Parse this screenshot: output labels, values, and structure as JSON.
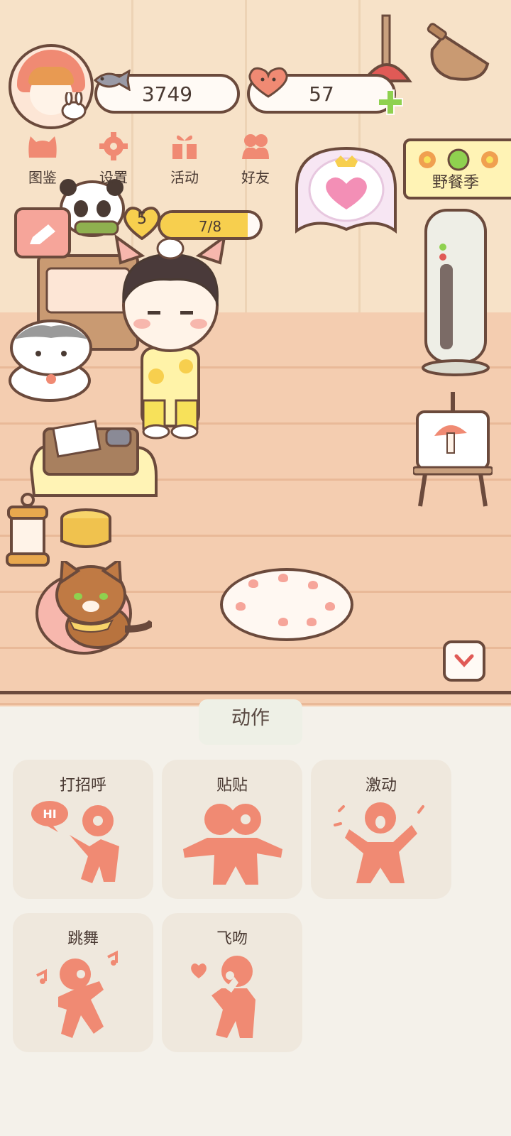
{
  "hud": {
    "coins": "3749",
    "hearts": "57"
  },
  "menu": [
    {
      "label": "图鉴",
      "icon": "cat-face-icon"
    },
    {
      "label": "设置",
      "icon": "gear-icon"
    },
    {
      "label": "活动",
      "icon": "gift-icon"
    },
    {
      "label": "好友",
      "icon": "friends-icon"
    }
  ],
  "event_banner": {
    "label": "野餐季"
  },
  "player": {
    "level": "5",
    "progress_text": "7/8",
    "progress_fraction": 0.875
  },
  "actions_panel": {
    "title": "动作",
    "actions": [
      {
        "label": "打招呼",
        "icon": "wave-hi-icon"
      },
      {
        "label": "贴贴",
        "icon": "hug-icon"
      },
      {
        "label": "激动",
        "icon": "excited-icon"
      },
      {
        "label": "跳舞",
        "icon": "dance-icon"
      },
      {
        "label": "飞吻",
        "icon": "blow-kiss-icon"
      }
    ],
    "bubble_text": "HI"
  },
  "colors": {
    "accent": "#f08a73",
    "outline": "#6b4a3c",
    "progress_fill": "#f7cf4e",
    "plus": "#8fd14f",
    "panel_bg": "#f4f1ea",
    "card_bg": "#efe8dd"
  }
}
